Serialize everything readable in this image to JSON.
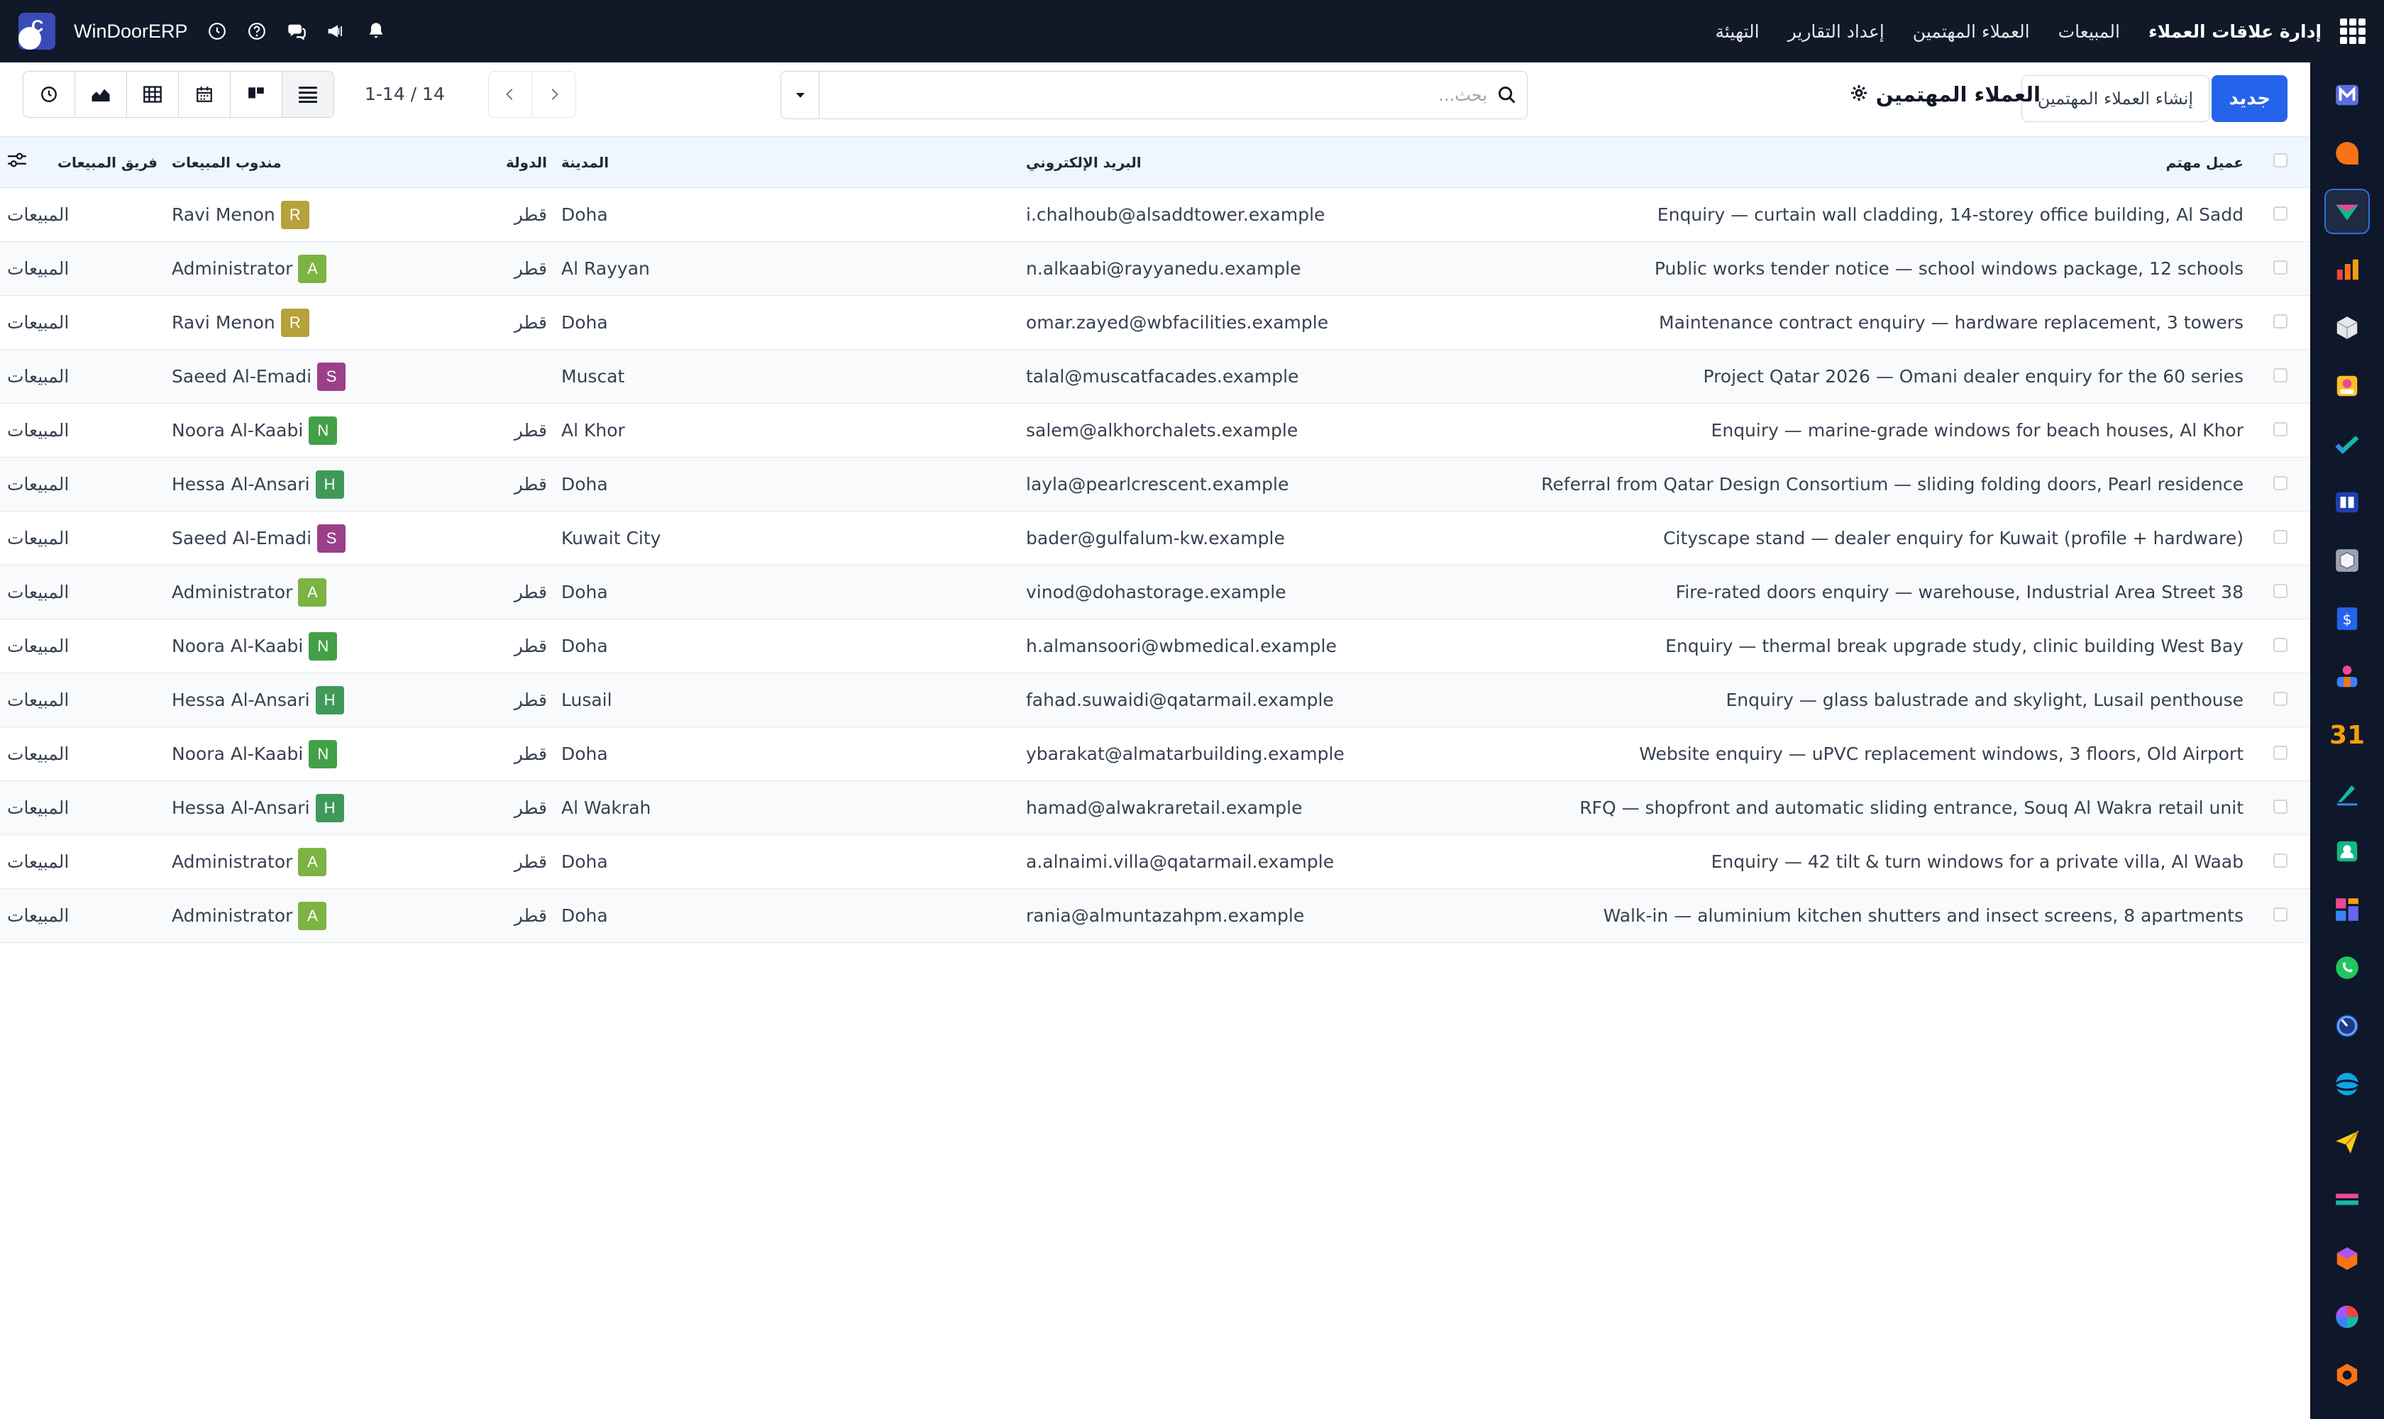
{
  "topbar": {
    "brand": "إدارة علاقات العملاء",
    "menu": [
      "المبيعات",
      "العملاء المهتمين",
      "إعداد التقارير",
      "التهيئة"
    ],
    "erp_name": "WinDoorERP",
    "icons": [
      "clock-icon",
      "help-icon",
      "chat-icon",
      "megaphone-icon",
      "bell-icon"
    ]
  },
  "control": {
    "new_label": "جديد",
    "create_label": "إنشاء العملاء المهتمين",
    "title": "العملاء المهتمين",
    "search_placeholder": "بحث...",
    "pager": "1-14 / 14"
  },
  "table": {
    "columns": {
      "lead": "عميل مهتم",
      "email": "البريد الإلكتروني",
      "city": "المدينة",
      "country": "الدولة",
      "salesperson": "مندوب المبيعات",
      "team": "فريق المبيعات"
    },
    "rows": [
      {
        "lead": "Enquiry — curtain wall cladding, 14-storey office building, Al Sadd",
        "email": "i.chalhoub@alsaddtower.example",
        "city": "Doha",
        "country": "قطر",
        "salesperson": "Ravi Menon",
        "initial": "R",
        "avatar_color": "#b7a13a",
        "team": "المبيعات"
      },
      {
        "lead": "Public works tender notice — school windows package, 12 schools",
        "email": "n.alkaabi@rayyanedu.example",
        "city": "Al Rayyan",
        "country": "قطر",
        "salesperson": "Administrator",
        "initial": "A",
        "avatar_color": "#7cb342",
        "team": "المبيعات"
      },
      {
        "lead": "Maintenance contract enquiry — hardware replacement, 3 towers",
        "email": "omar.zayed@wbfacilities.example",
        "city": "Doha",
        "country": "قطر",
        "salesperson": "Ravi Menon",
        "initial": "R",
        "avatar_color": "#b7a13a",
        "team": "المبيعات"
      },
      {
        "lead": "Project Qatar 2026 — Omani dealer enquiry for the 60 series",
        "email": "talal@muscatfacades.example",
        "city": "Muscat",
        "country": "",
        "salesperson": "Saeed Al-Emadi",
        "initial": "S",
        "avatar_color": "#9c3f8b",
        "team": "المبيعات"
      },
      {
        "lead": "Enquiry — marine-grade windows for beach houses, Al Khor",
        "email": "salem@alkhorchalets.example",
        "city": "Al Khor",
        "country": "قطر",
        "salesperson": "Noora Al-Kaabi",
        "initial": "N",
        "avatar_color": "#43a047",
        "team": "المبيعات"
      },
      {
        "lead": "Referral from Qatar Design Consortium — sliding folding doors, Pearl residence",
        "email": "layla@pearlcrescent.example",
        "city": "Doha",
        "country": "قطر",
        "salesperson": "Hessa Al-Ansari",
        "initial": "H",
        "avatar_color": "#3f9a5a",
        "team": "المبيعات"
      },
      {
        "lead": "Cityscape stand — dealer enquiry for Kuwait (profile + hardware)",
        "email": "bader@gulfalum-kw.example",
        "city": "Kuwait City",
        "country": "",
        "salesperson": "Saeed Al-Emadi",
        "initial": "S",
        "avatar_color": "#9c3f8b",
        "team": "المبيعات"
      },
      {
        "lead": "Fire-rated doors enquiry — warehouse, Industrial Area Street 38",
        "email": "vinod@dohastorage.example",
        "city": "Doha",
        "country": "قطر",
        "salesperson": "Administrator",
        "initial": "A",
        "avatar_color": "#7cb342",
        "team": "المبيعات"
      },
      {
        "lead": "Enquiry — thermal break upgrade study, clinic building West Bay",
        "email": "h.almansoori@wbmedical.example",
        "city": "Doha",
        "country": "قطر",
        "salesperson": "Noora Al-Kaabi",
        "initial": "N",
        "avatar_color": "#43a047",
        "team": "المبيعات"
      },
      {
        "lead": "Enquiry — glass balustrade and skylight, Lusail penthouse",
        "email": "fahad.suwaidi@qatarmail.example",
        "city": "Lusail",
        "country": "قطر",
        "salesperson": "Hessa Al-Ansari",
        "initial": "H",
        "avatar_color": "#3f9a5a",
        "team": "المبيعات"
      },
      {
        "lead": "Website enquiry — uPVC replacement windows, 3 floors, Old Airport",
        "email": "ybarakat@almatarbuilding.example",
        "city": "Doha",
        "country": "قطر",
        "salesperson": "Noora Al-Kaabi",
        "initial": "N",
        "avatar_color": "#43a047",
        "team": "المبيعات"
      },
      {
        "lead": "RFQ — shopfront and automatic sliding entrance, Souq Al Wakra retail unit",
        "email": "hamad@alwakraretail.example",
        "city": "Al Wakrah",
        "country": "قطر",
        "salesperson": "Hessa Al-Ansari",
        "initial": "H",
        "avatar_color": "#3f9a5a",
        "team": "المبيعات"
      },
      {
        "lead": "Enquiry — 42 tilt & turn windows for a private villa, Al Waab",
        "email": "a.alnaimi.villa@qatarmail.example",
        "city": "Doha",
        "country": "قطر",
        "salesperson": "Administrator",
        "initial": "A",
        "avatar_color": "#7cb342",
        "team": "المبيعات"
      },
      {
        "lead": "Walk-in — aluminium kitchen shutters and insect screens, 8 apartments",
        "email": "rania@almuntazahpm.example",
        "city": "Doha",
        "country": "قطر",
        "salesperson": "Administrator",
        "initial": "A",
        "avatar_color": "#7cb342",
        "team": "المبيعات"
      }
    ]
  },
  "rail": {
    "apps": [
      "mail-app-icon",
      "discuss-app-icon",
      "crm-app-icon",
      "sales-app-icon",
      "inventory-app-icon",
      "contacts-app-icon",
      "project-app-icon",
      "knowledge-app-icon",
      "purchase-app-icon",
      "invoicing-app-icon",
      "employees-app-icon",
      "calendar-app-icon",
      "sign-app-icon",
      "contacts-card-app-icon",
      "dashboard-app-icon",
      "whatsapp-app-icon",
      "timer-app-icon",
      "website-app-icon",
      "email-marketing-app-icon",
      "studio-app-icon",
      "modules-app-icon",
      "planning-app-icon",
      "settings-app-icon"
    ],
    "calendar_label": "31"
  }
}
